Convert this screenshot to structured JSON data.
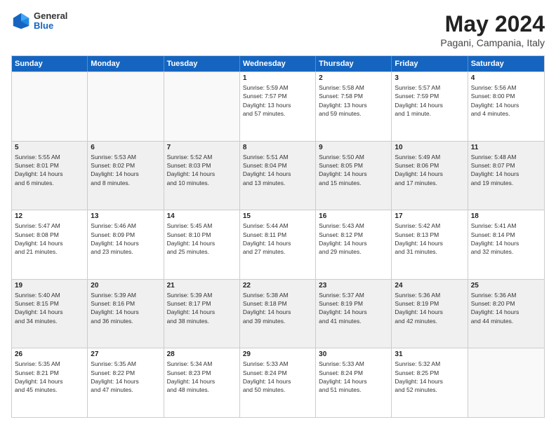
{
  "header": {
    "logo": {
      "general": "General",
      "blue": "Blue"
    },
    "title": "May 2024",
    "location": "Pagani, Campania, Italy"
  },
  "calendar": {
    "days": [
      "Sunday",
      "Monday",
      "Tuesday",
      "Wednesday",
      "Thursday",
      "Friday",
      "Saturday"
    ],
    "weeks": [
      [
        {
          "day": "",
          "info": "",
          "empty": true
        },
        {
          "day": "",
          "info": "",
          "empty": true
        },
        {
          "day": "",
          "info": "",
          "empty": true
        },
        {
          "day": "1",
          "info": "Sunrise: 5:59 AM\nSunset: 7:57 PM\nDaylight: 13 hours\nand 57 minutes."
        },
        {
          "day": "2",
          "info": "Sunrise: 5:58 AM\nSunset: 7:58 PM\nDaylight: 13 hours\nand 59 minutes."
        },
        {
          "day": "3",
          "info": "Sunrise: 5:57 AM\nSunset: 7:59 PM\nDaylight: 14 hours\nand 1 minute."
        },
        {
          "day": "4",
          "info": "Sunrise: 5:56 AM\nSunset: 8:00 PM\nDaylight: 14 hours\nand 4 minutes."
        }
      ],
      [
        {
          "day": "5",
          "info": "Sunrise: 5:55 AM\nSunset: 8:01 PM\nDaylight: 14 hours\nand 6 minutes.",
          "shaded": true
        },
        {
          "day": "6",
          "info": "Sunrise: 5:53 AM\nSunset: 8:02 PM\nDaylight: 14 hours\nand 8 minutes.",
          "shaded": true
        },
        {
          "day": "7",
          "info": "Sunrise: 5:52 AM\nSunset: 8:03 PM\nDaylight: 14 hours\nand 10 minutes.",
          "shaded": true
        },
        {
          "day": "8",
          "info": "Sunrise: 5:51 AM\nSunset: 8:04 PM\nDaylight: 14 hours\nand 13 minutes.",
          "shaded": true
        },
        {
          "day": "9",
          "info": "Sunrise: 5:50 AM\nSunset: 8:05 PM\nDaylight: 14 hours\nand 15 minutes.",
          "shaded": true
        },
        {
          "day": "10",
          "info": "Sunrise: 5:49 AM\nSunset: 8:06 PM\nDaylight: 14 hours\nand 17 minutes.",
          "shaded": true
        },
        {
          "day": "11",
          "info": "Sunrise: 5:48 AM\nSunset: 8:07 PM\nDaylight: 14 hours\nand 19 minutes.",
          "shaded": true
        }
      ],
      [
        {
          "day": "12",
          "info": "Sunrise: 5:47 AM\nSunset: 8:08 PM\nDaylight: 14 hours\nand 21 minutes."
        },
        {
          "day": "13",
          "info": "Sunrise: 5:46 AM\nSunset: 8:09 PM\nDaylight: 14 hours\nand 23 minutes."
        },
        {
          "day": "14",
          "info": "Sunrise: 5:45 AM\nSunset: 8:10 PM\nDaylight: 14 hours\nand 25 minutes."
        },
        {
          "day": "15",
          "info": "Sunrise: 5:44 AM\nSunset: 8:11 PM\nDaylight: 14 hours\nand 27 minutes."
        },
        {
          "day": "16",
          "info": "Sunrise: 5:43 AM\nSunset: 8:12 PM\nDaylight: 14 hours\nand 29 minutes."
        },
        {
          "day": "17",
          "info": "Sunrise: 5:42 AM\nSunset: 8:13 PM\nDaylight: 14 hours\nand 31 minutes."
        },
        {
          "day": "18",
          "info": "Sunrise: 5:41 AM\nSunset: 8:14 PM\nDaylight: 14 hours\nand 32 minutes."
        }
      ],
      [
        {
          "day": "19",
          "info": "Sunrise: 5:40 AM\nSunset: 8:15 PM\nDaylight: 14 hours\nand 34 minutes.",
          "shaded": true
        },
        {
          "day": "20",
          "info": "Sunrise: 5:39 AM\nSunset: 8:16 PM\nDaylight: 14 hours\nand 36 minutes.",
          "shaded": true
        },
        {
          "day": "21",
          "info": "Sunrise: 5:39 AM\nSunset: 8:17 PM\nDaylight: 14 hours\nand 38 minutes.",
          "shaded": true
        },
        {
          "day": "22",
          "info": "Sunrise: 5:38 AM\nSunset: 8:18 PM\nDaylight: 14 hours\nand 39 minutes.",
          "shaded": true
        },
        {
          "day": "23",
          "info": "Sunrise: 5:37 AM\nSunset: 8:19 PM\nDaylight: 14 hours\nand 41 minutes.",
          "shaded": true
        },
        {
          "day": "24",
          "info": "Sunrise: 5:36 AM\nSunset: 8:19 PM\nDaylight: 14 hours\nand 42 minutes.",
          "shaded": true
        },
        {
          "day": "25",
          "info": "Sunrise: 5:36 AM\nSunset: 8:20 PM\nDaylight: 14 hours\nand 44 minutes.",
          "shaded": true
        }
      ],
      [
        {
          "day": "26",
          "info": "Sunrise: 5:35 AM\nSunset: 8:21 PM\nDaylight: 14 hours\nand 45 minutes."
        },
        {
          "day": "27",
          "info": "Sunrise: 5:35 AM\nSunset: 8:22 PM\nDaylight: 14 hours\nand 47 minutes."
        },
        {
          "day": "28",
          "info": "Sunrise: 5:34 AM\nSunset: 8:23 PM\nDaylight: 14 hours\nand 48 minutes."
        },
        {
          "day": "29",
          "info": "Sunrise: 5:33 AM\nSunset: 8:24 PM\nDaylight: 14 hours\nand 50 minutes."
        },
        {
          "day": "30",
          "info": "Sunrise: 5:33 AM\nSunset: 8:24 PM\nDaylight: 14 hours\nand 51 minutes."
        },
        {
          "day": "31",
          "info": "Sunrise: 5:32 AM\nSunset: 8:25 PM\nDaylight: 14 hours\nand 52 minutes."
        },
        {
          "day": "",
          "info": "",
          "empty": true
        }
      ]
    ]
  }
}
